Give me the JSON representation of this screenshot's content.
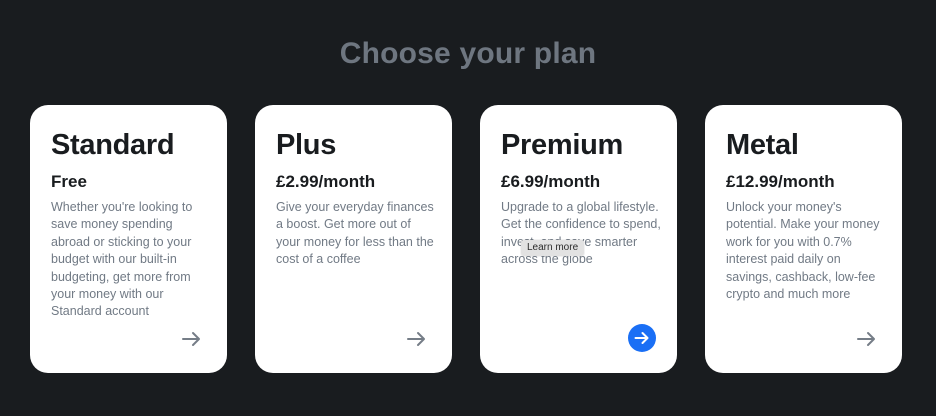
{
  "page": {
    "heading": "Choose your plan"
  },
  "colors": {
    "background": "#191c1f",
    "card": "#ffffff",
    "heading": "#6e7680",
    "accent": "#1a6ff5",
    "arrow": "#757d87"
  },
  "plans": [
    {
      "name": "Standard",
      "price": "Free",
      "description": "Whether you're looking to save money spending abroad or sticking to your budget with our built-in budgeting, get more from your money with our Standard account",
      "arrow_icon": "arrow-right-icon"
    },
    {
      "name": "Plus",
      "price": "£2.99/month",
      "description": "Give your everyday finances a boost. Get more out of your money for less than the cost of a coffee",
      "arrow_icon": "arrow-right-icon"
    },
    {
      "name": "Premium",
      "price": "£6.99/month",
      "description": "Upgrade to a global lifestyle. Get the confidence to spend, invest, and save smarter across the globe",
      "arrow_icon": "arrow-right-circle-icon",
      "highlighted": true
    },
    {
      "name": "Metal",
      "price": "£12.99/month",
      "description": "Unlock your money's potential. Make your money work for you with 0.7% interest paid daily on savings, cashback, low-fee crypto and much more",
      "arrow_icon": "arrow-right-icon"
    }
  ],
  "tooltip": {
    "text": "Learn more"
  }
}
